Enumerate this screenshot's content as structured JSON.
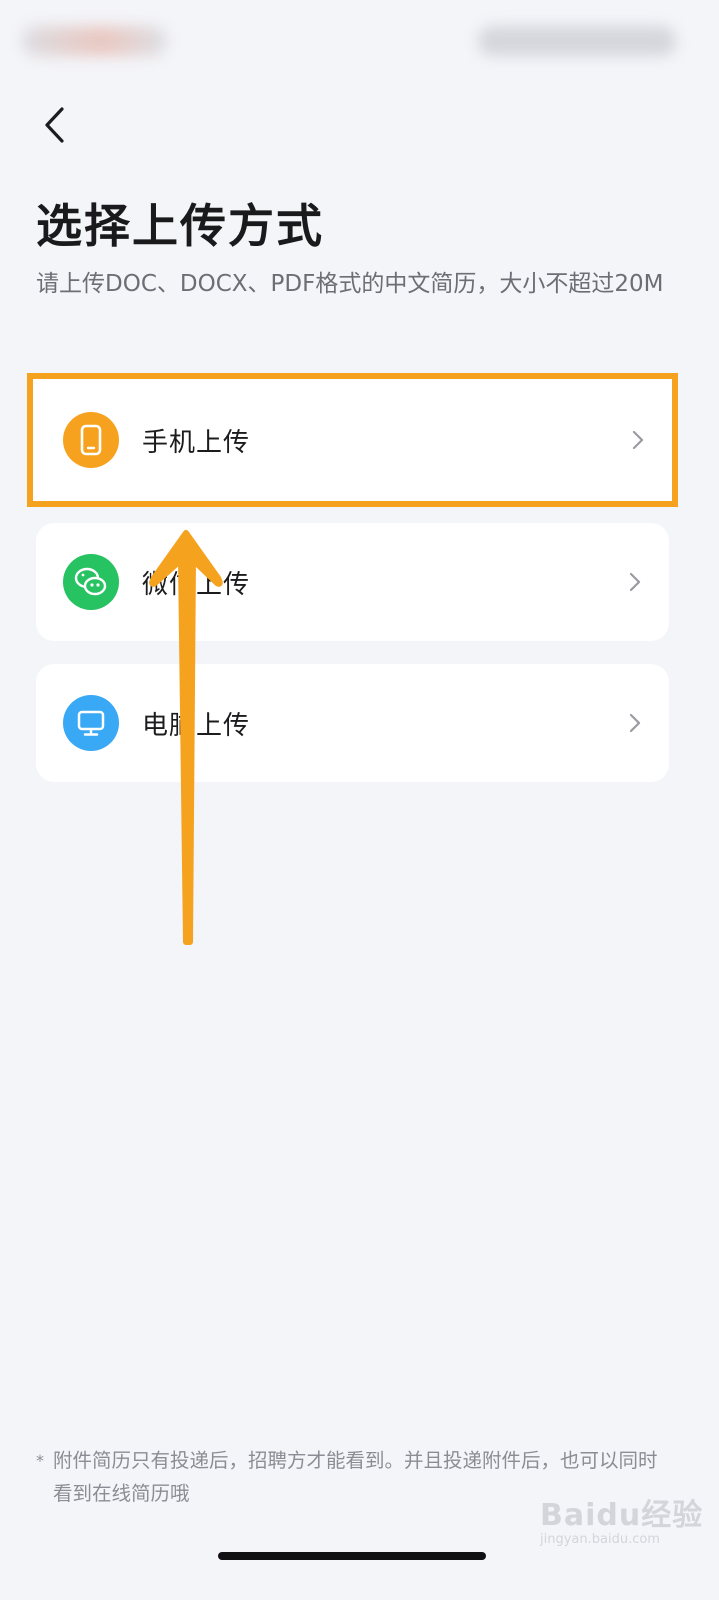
{
  "header": {
    "title": "选择上传方式",
    "subtitle": "请上传DOC、DOCX、PDF格式的中文简历，大小不超过20M"
  },
  "options": [
    {
      "label": "手机上传",
      "icon": "phone-icon",
      "icon_color": "#f6a21e",
      "highlighted": true
    },
    {
      "label": "微信上传",
      "icon": "wechat-icon",
      "icon_color": "#27c262",
      "highlighted": false
    },
    {
      "label": "电脑上传",
      "icon": "monitor-icon",
      "icon_color": "#39a9f5",
      "highlighted": false
    }
  ],
  "footer": {
    "star": "*",
    "note": "附件简历只有投递后，招聘方才能看到。并且投递附件后，也可以同时看到在线简历哦"
  },
  "watermark": {
    "brand": "Baidu经验",
    "url": "jingyan.baidu.com"
  },
  "colors": {
    "background": "#f4f5f9",
    "highlight_border": "#f5a21f",
    "annotation_arrow": "#f5a21f"
  }
}
